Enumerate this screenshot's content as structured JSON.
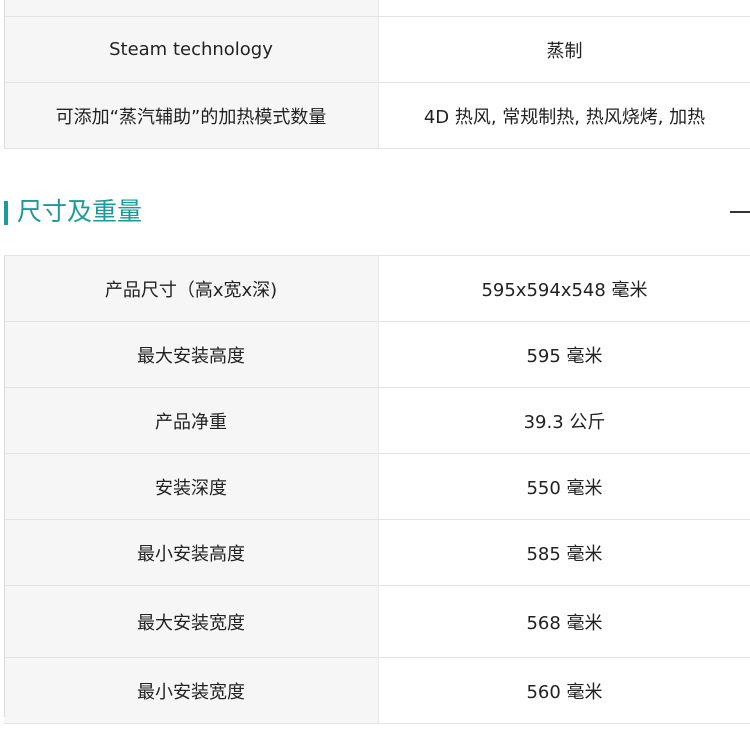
{
  "top_table": {
    "rows": [
      {
        "key": "Steam technology",
        "value": "蒸制"
      },
      {
        "key": "可添加“蒸汽辅助”的加热模式数量",
        "value": "4D 热风, 常规制热, 热风烧烤, 加热"
      }
    ]
  },
  "section": {
    "title": "尺寸及重量",
    "accent_color": "#1a9a98",
    "toggle_icon": "minus-icon"
  },
  "dimension_table": {
    "rows": [
      {
        "key": "产品尺寸（高x宽x深)",
        "value": "595x594x548 毫米"
      },
      {
        "key": "最大安装高度",
        "value": "595 毫米"
      },
      {
        "key": "产品净重",
        "value": "39.3 公斤"
      },
      {
        "key": "安装深度",
        "value": "550 毫米"
      },
      {
        "key": "最小安装高度",
        "value": "585 毫米"
      },
      {
        "key": "最大安装宽度",
        "value": "568 毫米"
      },
      {
        "key": "最小安装宽度",
        "value": "560 毫米"
      }
    ]
  }
}
